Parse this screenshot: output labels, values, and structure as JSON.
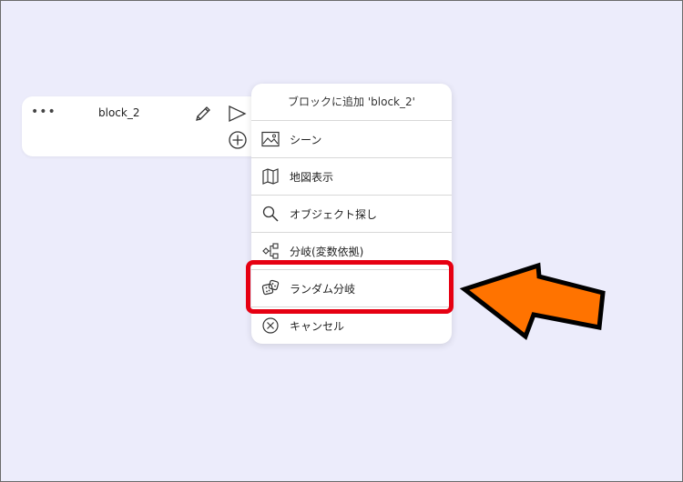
{
  "block": {
    "dots": "•••",
    "name": "block_2"
  },
  "menu": {
    "title": "ブロックに追加 'block_2'",
    "items": [
      {
        "label": "シーン",
        "icon": "image-icon"
      },
      {
        "label": "地図表示",
        "icon": "map-icon"
      },
      {
        "label": "オブジェクト探し",
        "icon": "search-icon"
      },
      {
        "label": "分岐(変数依拠)",
        "icon": "branch-icon"
      },
      {
        "label": "ランダム分岐",
        "icon": "dice-icon"
      },
      {
        "label": "キャンセル",
        "icon": "cancel-icon"
      }
    ]
  },
  "annotation": {
    "highlight_color": "#e60012",
    "arrow_color": "#ff7300"
  }
}
